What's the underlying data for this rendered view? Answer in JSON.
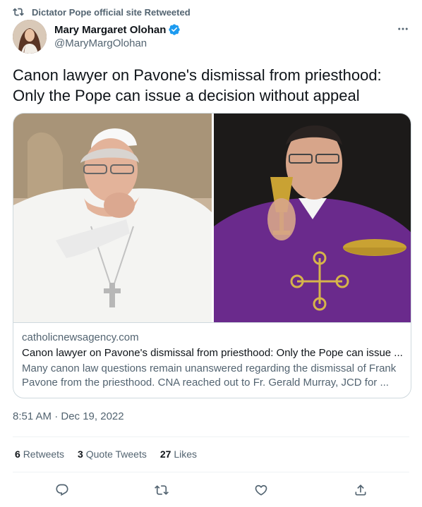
{
  "retweet": {
    "text": "Dictator Pope official site Retweeted",
    "icon": "retweet-icon"
  },
  "author": {
    "name": "Mary Margaret Olohan",
    "handle": "@MaryMargOlohan",
    "verified": true,
    "icon": "verified-badge-icon"
  },
  "more_icon": "more-options-icon",
  "tweet": {
    "text": "Canon lawyer on Pavone's dismissal from priesthood: Only the Pope can issue a decision without appeal"
  },
  "card": {
    "domain": "catholicnewsagency.com",
    "title": "Canon lawyer on Pavone's dismissal from priesthood: Only the Pope can issue ...",
    "description": "Many canon law questions remain unanswered regarding the dismissal of Frank Pavone from the priesthood. CNA reached out to Fr. Gerald Murray, JCD for ..."
  },
  "timestamp": "8:51 AM · Dec 19, 2022",
  "stats": {
    "retweets": {
      "count": "6",
      "label": "Retweets"
    },
    "quote_tweets": {
      "count": "3",
      "label": "Quote Tweets"
    },
    "likes": {
      "count": "27",
      "label": "Likes"
    }
  },
  "actions": [
    "reply-icon",
    "retweet-icon",
    "like-icon",
    "share-icon"
  ],
  "colors": {
    "text": "#0f1419",
    "secondary": "#536471",
    "border": "#cfd9de",
    "verified": "#1d9bf0",
    "vestment": "#6a2a8c"
  }
}
